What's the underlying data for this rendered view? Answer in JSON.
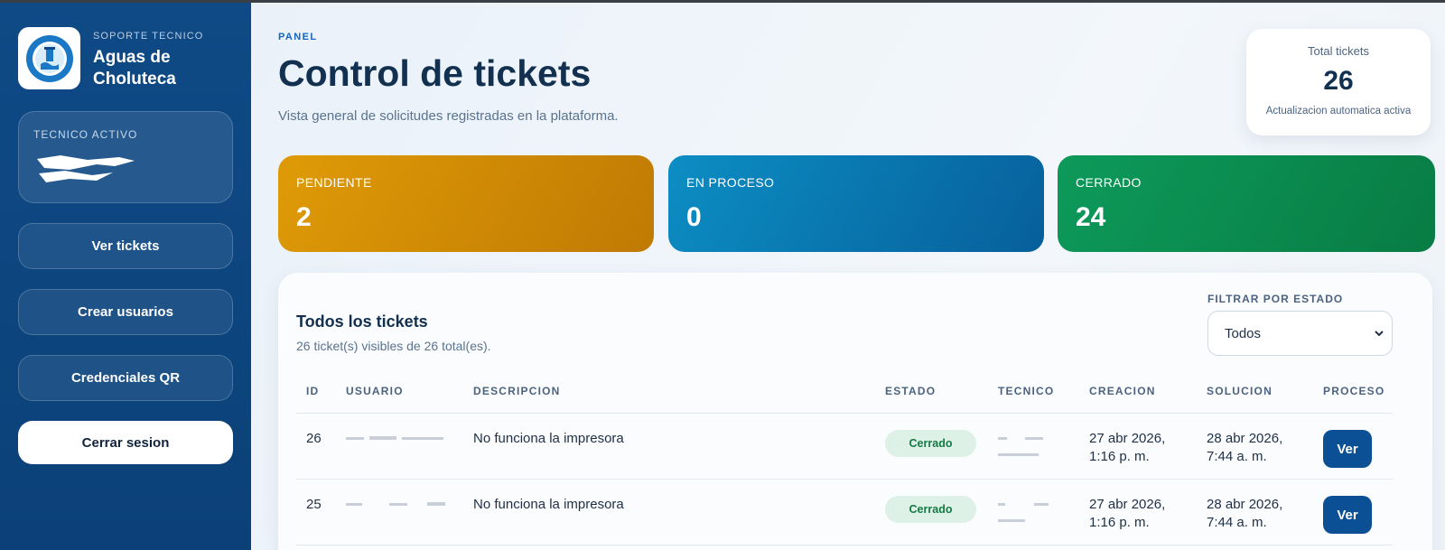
{
  "sidebar": {
    "kicker": "SOPORTE TECNICO",
    "brand_name": "Aguas de Choluteca",
    "active_label": "TECNICO ACTIVO",
    "nav": [
      {
        "label": "Ver tickets"
      },
      {
        "label": "Crear usuarios"
      },
      {
        "label": "Credenciales QR"
      }
    ],
    "logout_label": "Cerrar sesion"
  },
  "header": {
    "kicker": "PANEL",
    "title": "Control de tickets",
    "subtitle": "Vista general de solicitudes registradas en la plataforma."
  },
  "total_card": {
    "label": "Total tickets",
    "value": "26",
    "note": "Actualizacion automatica activa"
  },
  "stats": [
    {
      "label": "PENDIENTE",
      "value": "2",
      "color": "#df9b06"
    },
    {
      "label": "EN PROCESO",
      "value": "0",
      "color": "#0c8ec4"
    },
    {
      "label": "CERRADO",
      "value": "24",
      "color": "#0d9a5a"
    }
  ],
  "tickets_panel": {
    "title": "Todos los tickets",
    "subtitle": "26 ticket(s) visibles de 26 total(es).",
    "filter_label": "FILTRAR POR ESTADO",
    "filter_value": "Todos",
    "columns": [
      "ID",
      "USUARIO",
      "DESCRIPCION",
      "ESTADO",
      "TECNICO",
      "CREACION",
      "SOLUCION",
      "PROCESO"
    ],
    "rows": [
      {
        "id": "26",
        "descripcion": "No funciona la impresora",
        "estado": "Cerrado",
        "creacion_1": "27 abr 2026,",
        "creacion_2": "1:16 p. m.",
        "solucion_1": "28 abr 2026,",
        "solucion_2": "7:44 a. m.",
        "accion": "Ver"
      },
      {
        "id": "25",
        "descripcion": "No funciona la impresora",
        "estado": "Cerrado",
        "creacion_1": "27 abr 2026,",
        "creacion_2": "1:16 p. m.",
        "solucion_1": "28 abr 2026,",
        "solucion_2": "7:44 a. m.",
        "accion": "Ver"
      }
    ]
  },
  "colors": {
    "sidebar": "#0f4a86",
    "title": "#12304f",
    "accent": "#1565c0",
    "badge_closed_bg": "#ddf1e6",
    "badge_closed_text": "#137a45",
    "action_button": "#0b4f95"
  },
  "icons": {
    "logo": "aguas-de-choluteca-logo",
    "select_caret": "chevron-down-icon"
  }
}
